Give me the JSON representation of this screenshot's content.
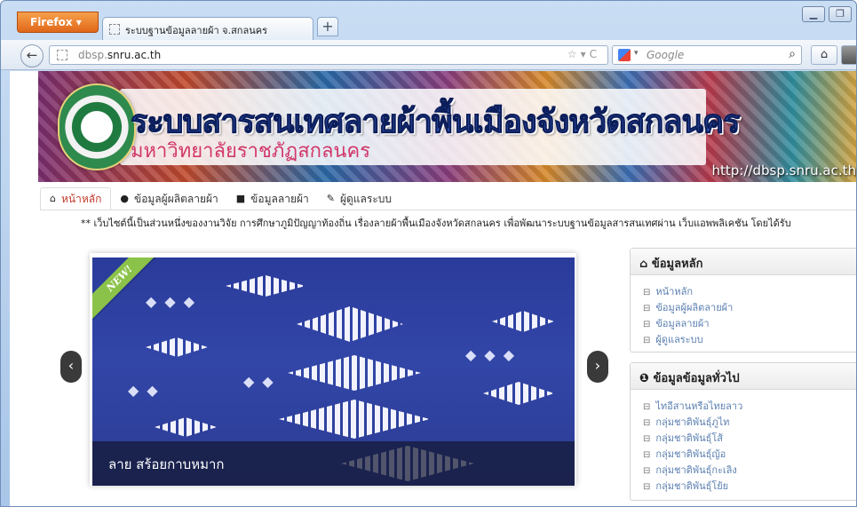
{
  "browser": {
    "app_button": "Firefox",
    "tab_title": "ระบบฐานข้อมูลลายผ้า จ.สกลนคร",
    "new_tab": "+",
    "url_prefix": "dbsp.",
    "url_domain": "snru.ac.th",
    "search_placeholder": "Google"
  },
  "banner": {
    "title": "ระบบสารสนเทศลายผ้าพื้นเมืองจังหวัดสกลนคร",
    "subtitle": "มหาวิทยาลัยราชภัฏสกลนคร",
    "url": "http://dbsp.snru.ac.th"
  },
  "menu": [
    {
      "label": "หน้าหลัก",
      "icon": "home-icon",
      "active": true
    },
    {
      "label": "ข้อมูลผู้ผลิตลายผ้า",
      "icon": "user-icon",
      "active": false
    },
    {
      "label": "ข้อมูลลายผ้า",
      "icon": "book-icon",
      "active": false
    },
    {
      "label": "ผู้ดูแลระบบ",
      "icon": "wrench-icon",
      "active": false
    }
  ],
  "marquee": "** เว็บไซต์นี้เป็นส่วนหนึ่งของงานวิจัย การศึกษาภูมิปัญญาท้องถิ่น เรื่องลายผ้าพื้นเมืองจังหวัดสกลนคร เพื่อพัฒนาระบบฐานข้อมูลสารสนเทศผ่าน เว็บแอพพลิเคชัน โดยได้รับ",
  "slider": {
    "ribbon": "NEW!",
    "caption": "ลาย สร้อยกาบหมาก"
  },
  "main_panel": {
    "title": "ข้อมูลหลัก",
    "items": [
      "หน้าหลัก",
      "ข้อมูลผู้ผลิตลายผ้า",
      "ข้อมูลลายผ้า",
      "ผู้ดูแลระบบ"
    ]
  },
  "info_panel": {
    "title": "ข้อมูลข้อมูลทั่วไป",
    "items": [
      "ไทอีสานหรือไทยลาว",
      "กลุ่มชาติพันธุ์ภูไท",
      "กลุ่มชาติพันธุ์โส้",
      "กลุ่มชาติพันธุ์ญ้อ",
      "กลุ่มชาติพันธุ์กะเลิง",
      "กลุ่มชาติพันธุ์โย้ย"
    ]
  }
}
